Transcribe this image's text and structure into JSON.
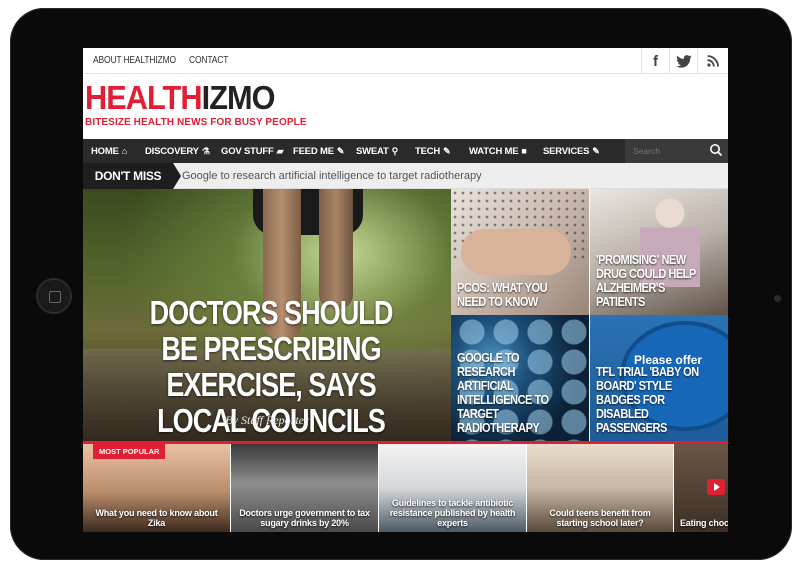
{
  "topbar": {
    "links": [
      "ABOUT HEALTHIZMO",
      "CONTACT"
    ],
    "social": {
      "facebook": "f",
      "twitter": "twitter-icon",
      "rss": "rss-icon"
    }
  },
  "brand": {
    "logo_red": "HEALTH",
    "logo_dark": "IZMO",
    "tagline": "BITESIZE HEALTH NEWS FOR BUSY PEOPLE",
    "accent": "#e01f33"
  },
  "nav": {
    "items": [
      "HOME",
      "DISCOVERY",
      "GOV STUFF",
      "FEED ME",
      "SWEAT",
      "TECH",
      "WATCH ME",
      "SERVICES"
    ],
    "search_placeholder": "Search"
  },
  "ticker": {
    "label": "DON'T MISS",
    "text": "Google to research artificial intelligence to target radiotherapy"
  },
  "hero": {
    "title": "DOCTORS SHOULD BE PRESCRIBING EXERCISE, SAYS LOCAL COUNCILS",
    "byline": "By Staff Reporter"
  },
  "tiles": [
    {
      "title": "PCOS: WHAT YOU NEED TO KNOW"
    },
    {
      "title": "'PROMISING' NEW DRUG COULD HELP ALZHEIMER'S PATIENTS"
    },
    {
      "title": "GOOGLE TO RESEARCH ARTIFICIAL INTELLIGENCE TO TARGET RADIOTHERAPY"
    },
    {
      "title": "TFL TRIAL 'BABY ON BOARD' STYLE BADGES FOR DISABLED PASSENGERS",
      "badge_text": "Please offer"
    }
  ],
  "popular": {
    "tag": "MOST POPULAR",
    "items": [
      {
        "caption": "What you need to know about Zika"
      },
      {
        "caption": "Doctors urge government to tax sugary drinks by 20%"
      },
      {
        "caption": "Guidelines to tackle antibiotic resistance published by health experts"
      },
      {
        "caption": "Could teens benefit from starting school later?"
      },
      {
        "caption": "Eating choco"
      }
    ]
  }
}
